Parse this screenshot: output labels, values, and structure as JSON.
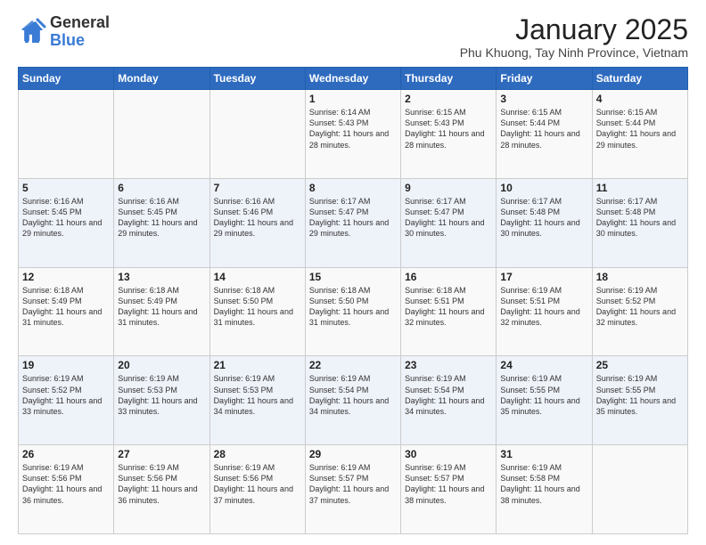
{
  "header": {
    "logo_general": "General",
    "logo_blue": "Blue",
    "month_year": "January 2025",
    "location": "Phu Khuong, Tay Ninh Province, Vietnam"
  },
  "days_of_week": [
    "Sunday",
    "Monday",
    "Tuesday",
    "Wednesday",
    "Thursday",
    "Friday",
    "Saturday"
  ],
  "weeks": [
    [
      {
        "day": "",
        "info": ""
      },
      {
        "day": "",
        "info": ""
      },
      {
        "day": "",
        "info": ""
      },
      {
        "day": "1",
        "info": "Sunrise: 6:14 AM\nSunset: 5:43 PM\nDaylight: 11 hours\nand 28 minutes."
      },
      {
        "day": "2",
        "info": "Sunrise: 6:15 AM\nSunset: 5:43 PM\nDaylight: 11 hours\nand 28 minutes."
      },
      {
        "day": "3",
        "info": "Sunrise: 6:15 AM\nSunset: 5:44 PM\nDaylight: 11 hours\nand 28 minutes."
      },
      {
        "day": "4",
        "info": "Sunrise: 6:15 AM\nSunset: 5:44 PM\nDaylight: 11 hours\nand 29 minutes."
      }
    ],
    [
      {
        "day": "5",
        "info": "Sunrise: 6:16 AM\nSunset: 5:45 PM\nDaylight: 11 hours\nand 29 minutes."
      },
      {
        "day": "6",
        "info": "Sunrise: 6:16 AM\nSunset: 5:45 PM\nDaylight: 11 hours\nand 29 minutes."
      },
      {
        "day": "7",
        "info": "Sunrise: 6:16 AM\nSunset: 5:46 PM\nDaylight: 11 hours\nand 29 minutes."
      },
      {
        "day": "8",
        "info": "Sunrise: 6:17 AM\nSunset: 5:47 PM\nDaylight: 11 hours\nand 29 minutes."
      },
      {
        "day": "9",
        "info": "Sunrise: 6:17 AM\nSunset: 5:47 PM\nDaylight: 11 hours\nand 30 minutes."
      },
      {
        "day": "10",
        "info": "Sunrise: 6:17 AM\nSunset: 5:48 PM\nDaylight: 11 hours\nand 30 minutes."
      },
      {
        "day": "11",
        "info": "Sunrise: 6:17 AM\nSunset: 5:48 PM\nDaylight: 11 hours\nand 30 minutes."
      }
    ],
    [
      {
        "day": "12",
        "info": "Sunrise: 6:18 AM\nSunset: 5:49 PM\nDaylight: 11 hours\nand 31 minutes."
      },
      {
        "day": "13",
        "info": "Sunrise: 6:18 AM\nSunset: 5:49 PM\nDaylight: 11 hours\nand 31 minutes."
      },
      {
        "day": "14",
        "info": "Sunrise: 6:18 AM\nSunset: 5:50 PM\nDaylight: 11 hours\nand 31 minutes."
      },
      {
        "day": "15",
        "info": "Sunrise: 6:18 AM\nSunset: 5:50 PM\nDaylight: 11 hours\nand 31 minutes."
      },
      {
        "day": "16",
        "info": "Sunrise: 6:18 AM\nSunset: 5:51 PM\nDaylight: 11 hours\nand 32 minutes."
      },
      {
        "day": "17",
        "info": "Sunrise: 6:19 AM\nSunset: 5:51 PM\nDaylight: 11 hours\nand 32 minutes."
      },
      {
        "day": "18",
        "info": "Sunrise: 6:19 AM\nSunset: 5:52 PM\nDaylight: 11 hours\nand 32 minutes."
      }
    ],
    [
      {
        "day": "19",
        "info": "Sunrise: 6:19 AM\nSunset: 5:52 PM\nDaylight: 11 hours\nand 33 minutes."
      },
      {
        "day": "20",
        "info": "Sunrise: 6:19 AM\nSunset: 5:53 PM\nDaylight: 11 hours\nand 33 minutes."
      },
      {
        "day": "21",
        "info": "Sunrise: 6:19 AM\nSunset: 5:53 PM\nDaylight: 11 hours\nand 34 minutes."
      },
      {
        "day": "22",
        "info": "Sunrise: 6:19 AM\nSunset: 5:54 PM\nDaylight: 11 hours\nand 34 minutes."
      },
      {
        "day": "23",
        "info": "Sunrise: 6:19 AM\nSunset: 5:54 PM\nDaylight: 11 hours\nand 34 minutes."
      },
      {
        "day": "24",
        "info": "Sunrise: 6:19 AM\nSunset: 5:55 PM\nDaylight: 11 hours\nand 35 minutes."
      },
      {
        "day": "25",
        "info": "Sunrise: 6:19 AM\nSunset: 5:55 PM\nDaylight: 11 hours\nand 35 minutes."
      }
    ],
    [
      {
        "day": "26",
        "info": "Sunrise: 6:19 AM\nSunset: 5:56 PM\nDaylight: 11 hours\nand 36 minutes."
      },
      {
        "day": "27",
        "info": "Sunrise: 6:19 AM\nSunset: 5:56 PM\nDaylight: 11 hours\nand 36 minutes."
      },
      {
        "day": "28",
        "info": "Sunrise: 6:19 AM\nSunset: 5:56 PM\nDaylight: 11 hours\nand 37 minutes."
      },
      {
        "day": "29",
        "info": "Sunrise: 6:19 AM\nSunset: 5:57 PM\nDaylight: 11 hours\nand 37 minutes."
      },
      {
        "day": "30",
        "info": "Sunrise: 6:19 AM\nSunset: 5:57 PM\nDaylight: 11 hours\nand 38 minutes."
      },
      {
        "day": "31",
        "info": "Sunrise: 6:19 AM\nSunset: 5:58 PM\nDaylight: 11 hours\nand 38 minutes."
      },
      {
        "day": "",
        "info": ""
      }
    ]
  ]
}
